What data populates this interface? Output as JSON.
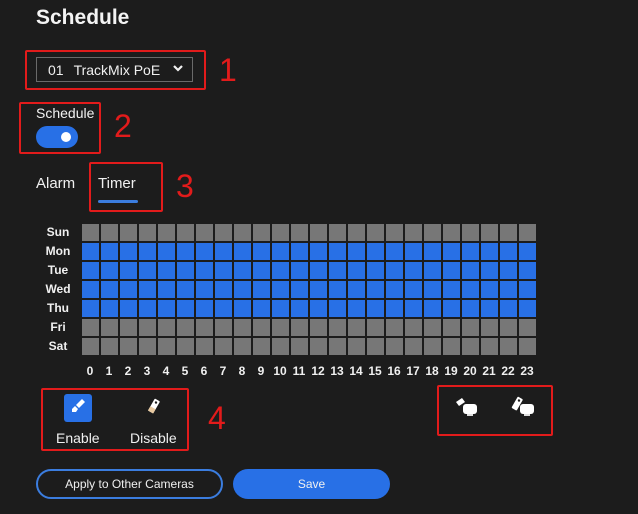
{
  "page": {
    "title": "Schedule"
  },
  "camera_select": {
    "number": "01",
    "name": "TrackMix PoE",
    "icon": "chevron-down-icon"
  },
  "schedule_toggle": {
    "label": "Schedule",
    "enabled": true
  },
  "tabs": [
    {
      "label": "Alarm",
      "active": false
    },
    {
      "label": "Timer",
      "active": true
    }
  ],
  "grid": {
    "days": [
      "Sun",
      "Mon",
      "Tue",
      "Wed",
      "Thu",
      "Fri",
      "Sat"
    ],
    "hours": [
      "0",
      "1",
      "2",
      "3",
      "4",
      "5",
      "6",
      "7",
      "8",
      "9",
      "10",
      "11",
      "12",
      "13",
      "14",
      "15",
      "16",
      "17",
      "18",
      "19",
      "20",
      "21",
      "22",
      "23"
    ],
    "enabled_days": [
      "Mon",
      "Tue",
      "Wed",
      "Thu"
    ],
    "colors": {
      "enabled": "#2870e6",
      "disabled": "#777777"
    }
  },
  "tools": {
    "enable": {
      "label": "Enable",
      "icon": "brush-icon",
      "active": true
    },
    "disable": {
      "label": "Disable",
      "icon": "eraser-icon",
      "active": false
    },
    "enable_all": {
      "icon": "brush-all-icon"
    },
    "disable_all": {
      "icon": "eraser-all-icon"
    }
  },
  "annotations": [
    "1",
    "2",
    "3",
    "4"
  ],
  "buttons": {
    "apply": "Apply to Other Cameras",
    "save": "Save"
  },
  "colors": {
    "accent": "#2870e6",
    "annotation": "#e21b1b",
    "background": "#1c1c1c"
  }
}
